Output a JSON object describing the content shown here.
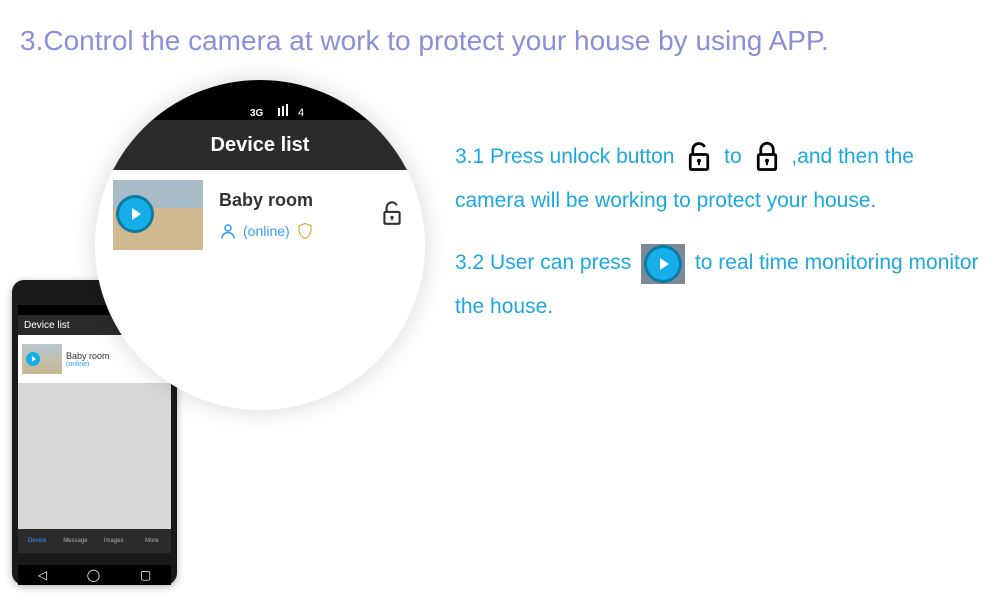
{
  "heading": "3.Control the camera at work to protect your house by using APP.",
  "zoom": {
    "header": "Device list",
    "device_name": "Baby room",
    "status": "(online)"
  },
  "phone": {
    "header": "Device list",
    "device_name": "Baby room",
    "status": "(online)",
    "tabs": [
      "Device",
      "Message",
      "Images",
      "More"
    ]
  },
  "instructions": {
    "step1_a": "3.1 Press unlock button ",
    "step1_b": " to ",
    "step1_c": " ,and then the camera will be working to protect your house.",
    "step2_a": "3.2 User can press ",
    "step2_b": " to real time monitoring monitor the house."
  }
}
